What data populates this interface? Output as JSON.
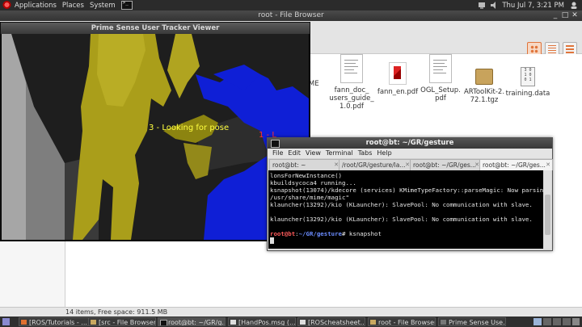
{
  "top_panel": {
    "menus": [
      "Applications",
      "Places",
      "System"
    ],
    "datetime": "Thu Jul  7,  3:21 PM"
  },
  "file_browser": {
    "title": "root - File Browser",
    "files": [
      {
        "name": "DME",
        "icon": "text-icon"
      },
      {
        "name": "fann_doc_ users_guide_ 1.0.pdf",
        "icon": "pdf-document-icon"
      },
      {
        "name": "fann_en.pdf",
        "icon": "pdf-icon"
      },
      {
        "name": "OGL_Setup. pdf",
        "icon": "pdf-document-icon"
      },
      {
        "name": "ARToolKit-2. 72.1.tgz",
        "icon": "archive-icon"
      },
      {
        "name": "training.data",
        "icon": "data-file-icon"
      }
    ],
    "status": "14 items, Free space: 911.5 MB"
  },
  "prime_sense": {
    "title": "Prime Sense User Tracker Viewer",
    "status_text": "3 - Looking for pose",
    "user_label_partial": "1 - L",
    "colors": {
      "user1": "#0a1ad0",
      "user3": "#b4a818",
      "wall": "#8a8a8a"
    }
  },
  "terminal": {
    "title": "root@bt: ~/GR/gesture",
    "menu": [
      "File",
      "Edit",
      "View",
      "Terminal",
      "Tabs",
      "Help"
    ],
    "tabs": [
      "root@bt: ~",
      "/root/GR/gesture/la...",
      "root@bt: ~/GR/ges...",
      "root@bt: ~/GR/ges..."
    ],
    "lines": [
      "lonsForNewInstance()",
      "kbuildsycoca4 running...",
      "ksnapshot(13074)/kdecore (services) KMimeTypeFactory::parseMagic: Now parsing  \"",
      "/usr/share/mime/magic\"",
      "klauncher(13292)/kio (KLauncher): SlavePool: No communication with slave.",
      "",
      "klauncher(13292)/kio (KLauncher): SlavePool: No communication with slave.",
      ""
    ],
    "prompt_user": "root@bt",
    "prompt_sep": ":",
    "prompt_path": "~/GR/gesture",
    "prompt_cmd": "# ksnapshot"
  },
  "taskbar": {
    "items": [
      "[ROS/Tutorials - ...",
      "[src - File Browser]",
      "root@bt: ~/GR/g...",
      "[HandPos.msg (...",
      "[ROScheatsheet....",
      "root - File Browser",
      "Prime Sense Use..."
    ]
  }
}
